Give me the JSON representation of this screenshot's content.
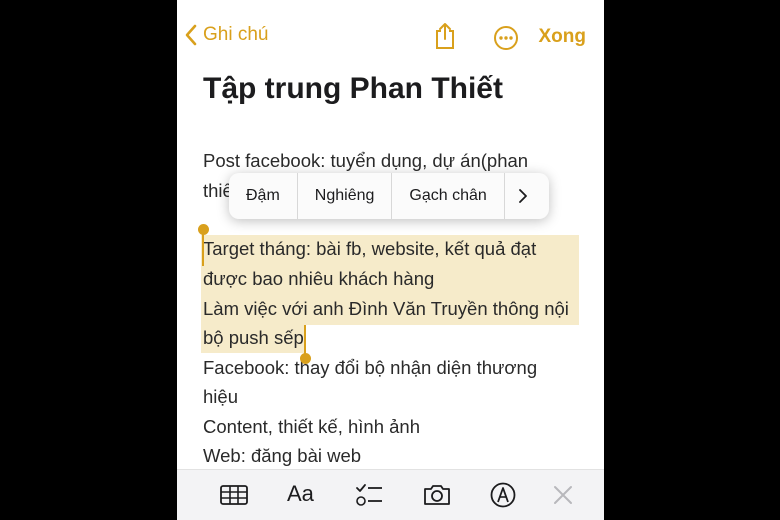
{
  "nav": {
    "back_label": "Ghi chú",
    "done_label": "Xong"
  },
  "note": {
    "title": "Tập trung Phan Thiết",
    "lines": [
      "Post facebook: tuyển dụng, dự án(phan",
      "thiế",
      "Target tháng: bài fb, website, kết quả đạt",
      "được bao nhiêu khách hàng",
      "Làm việc với anh Đình Văn Truyền thông nội",
      "bộ push sếp",
      "Facebook: thay đổi bộ nhận diện thương",
      "hiệu",
      "Content, thiết kế, hình ảnh",
      "Web: đăng bài web"
    ]
  },
  "context_menu": {
    "items": [
      "Đậm",
      "Nghiêng",
      "Gạch chân"
    ],
    "more_icon": "chevron-right-icon"
  },
  "toolbar": {
    "format_label": "Aa",
    "icons": [
      "table-icon",
      "checklist-icon",
      "camera-icon",
      "markup-icon",
      "close-icon"
    ]
  },
  "colors": {
    "accent": "#d9a01c",
    "highlight": "#f6ebca"
  }
}
